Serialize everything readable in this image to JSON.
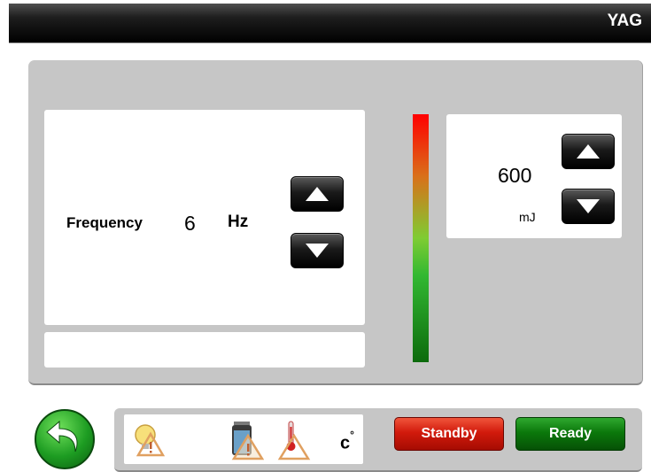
{
  "header": {
    "title": "YAG"
  },
  "frequency": {
    "label": "Frequency",
    "value": "6",
    "unit": "Hz"
  },
  "message": {
    "text": ""
  },
  "energy": {
    "value": "600",
    "unit": "mJ"
  },
  "status": {
    "temperature_unit": "c"
  },
  "actions": {
    "standby_label": "Standby",
    "ready_label": "Ready"
  },
  "colors": {
    "standby": "#d21a0c",
    "ready": "#0b780b",
    "level_top": "#ff0000",
    "level_bottom": "#0c6a0c",
    "warning": "#e0a060"
  },
  "icons": [
    "back-arrow-icon",
    "lamp-warning-icon",
    "water-tank-warning-icon",
    "temperature-warning-icon",
    "up-arrow-icon",
    "down-arrow-icon"
  ]
}
